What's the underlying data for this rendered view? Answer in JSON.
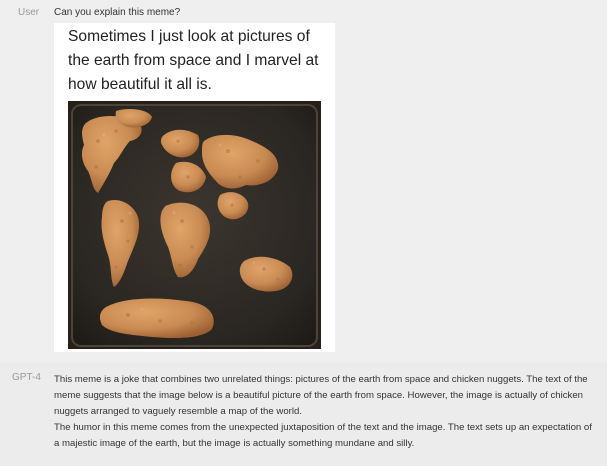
{
  "user": {
    "speaker": "User",
    "message": "Can you explain this meme?"
  },
  "meme": {
    "caption": "Sometimes I just look at pictures of the earth from space and I marvel at how beautiful it all is.",
    "photo_subject": "chicken nuggets arranged like a world map on a baking tray"
  },
  "assistant": {
    "speaker": "GPT-4",
    "paragraph_1": "This meme is a joke that combines two unrelated things: pictures of the earth from space and chicken nuggets. The text of the meme suggests that the image below is a beautiful picture of the earth from space. However, the image is actually of chicken nuggets arranged to vaguely resemble a map of the world.",
    "paragraph_2": "The humor in this meme comes from the unexpected juxtaposition of the text and the image. The text sets up an expectation of a majestic image of the earth, but the image is actually something mundane and silly."
  },
  "colors": {
    "tray": "#2e2a25",
    "nugget": "#c98b52",
    "nugget_dark": "#a8693a",
    "background": "#efefef"
  }
}
